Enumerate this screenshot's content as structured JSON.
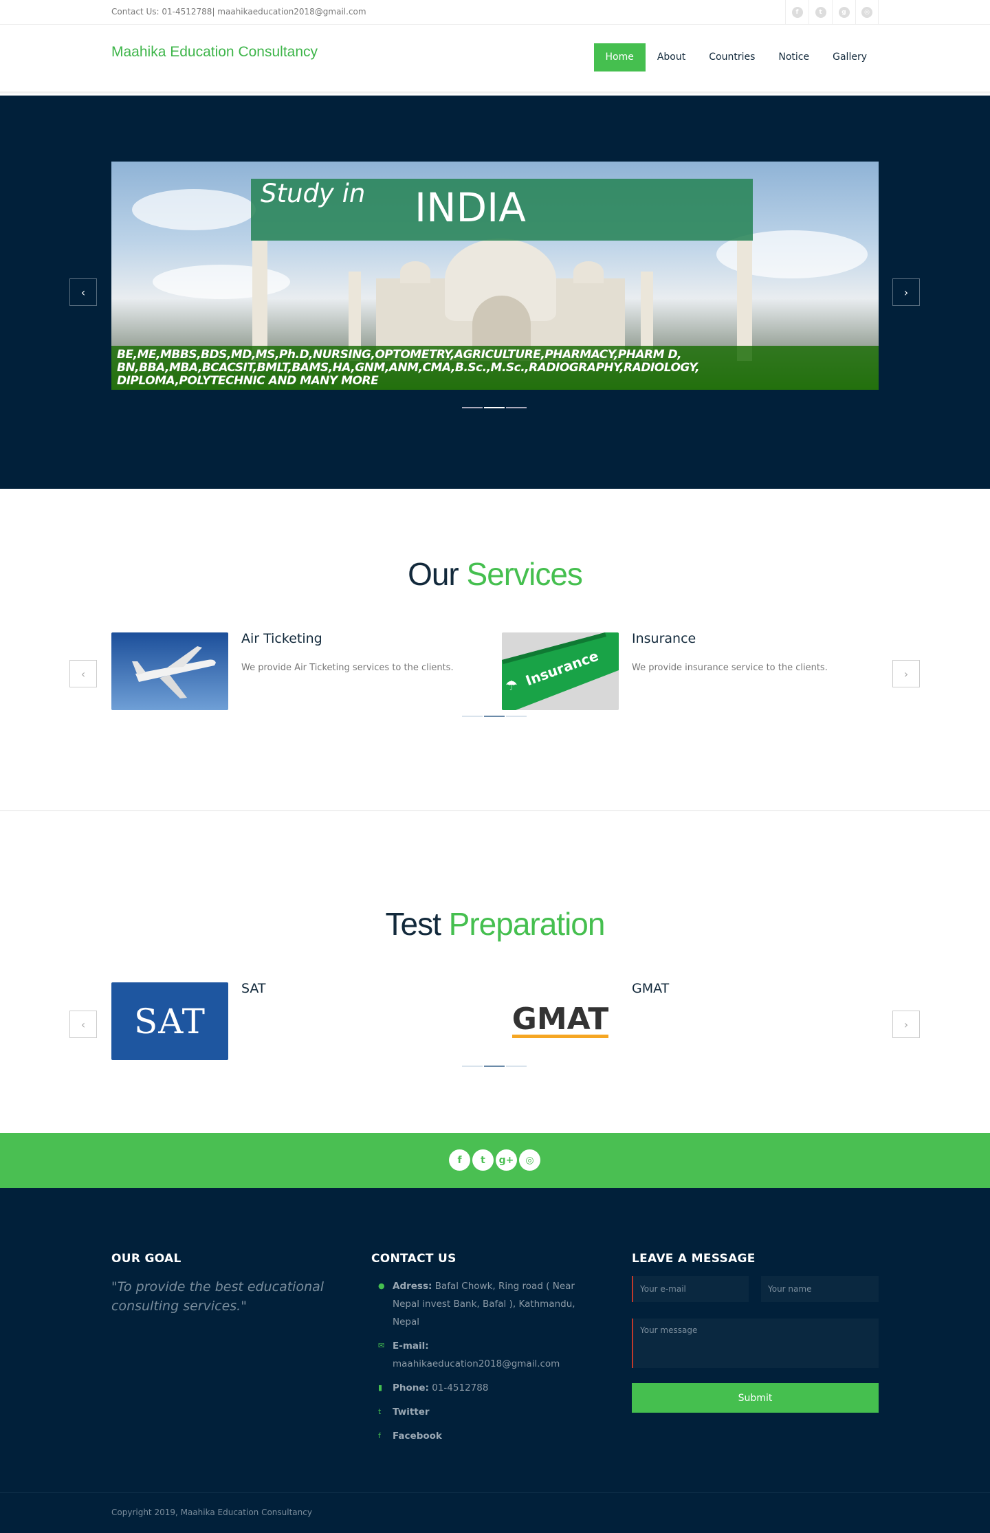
{
  "topbar": {
    "contact": "Contact Us: 01-4512788| maahikaeducation2018@gmail.com",
    "social_icons": [
      "facebook-icon",
      "twitter-icon",
      "google-plus-icon",
      "instagram-icon"
    ]
  },
  "header": {
    "logo": "Maahika Education Consultancy",
    "nav": [
      "Home",
      "About",
      "Countries",
      "Notice",
      "Gallery"
    ],
    "active": "Home"
  },
  "hero": {
    "slide_title_small": "Study in",
    "slide_title_big": "INDIA",
    "courses_line1": "BE,ME,MBBS,BDS,MD,MS,Ph.D,NURSING,OPTOMETRY,AGRICULTURE,PHARMACY,PHARM D,",
    "courses_line2": "BN,BBA,MBA,BCACSIT,BMLT,BAMS,HA,GNM,ANM,CMA,B.Sc.,M.Sc.,RADIOGRAPHY,RADIOLOGY,",
    "courses_line3": "DIPLOMA,POLYTECHNIC AND MANY MORE",
    "prev": "‹",
    "next": "›"
  },
  "services": {
    "title_part1": "Our",
    "title_part2": "Services",
    "items": [
      {
        "title": "Air Ticketing",
        "text": "We provide Air Ticketing services to the clients."
      },
      {
        "title": "Insurance",
        "text": "We provide insurance service to the clients.",
        "image_label": "Insurance"
      }
    ]
  },
  "test_prep": {
    "title_part1": "Test",
    "title_part2": "Preparation",
    "items": [
      {
        "title": "SAT",
        "logo_text": "SAT"
      },
      {
        "title": "GMAT",
        "logo_text": "GMAT"
      }
    ]
  },
  "footer": {
    "goal_heading": "OUR GOAL",
    "goal_text": "\"To provide the best educational consulting services.\"",
    "contact_heading": "CONTACT US",
    "address_label": "Adress:",
    "address_value": "Bafal Chowk, Ring road ( Near Nepal invest Bank, Bafal ), Kathmandu, Nepal",
    "email_label": "E-mail:",
    "email_value": "maahikaeducation2018@gmail.com",
    "phone_label": "Phone:",
    "phone_value": "01-4512788",
    "twitter": "Twitter",
    "facebook": "Facebook",
    "message_heading": "LEAVE A MESSAGE",
    "email_placeholder": "Your e-mail",
    "name_placeholder": "Your name",
    "message_placeholder": "Your message",
    "submit": "Submit",
    "copyright": "Copyright 2019, Maahika Education Consultancy"
  },
  "colors": {
    "brand_green": "#45bf4f",
    "navy": "#01203a"
  }
}
